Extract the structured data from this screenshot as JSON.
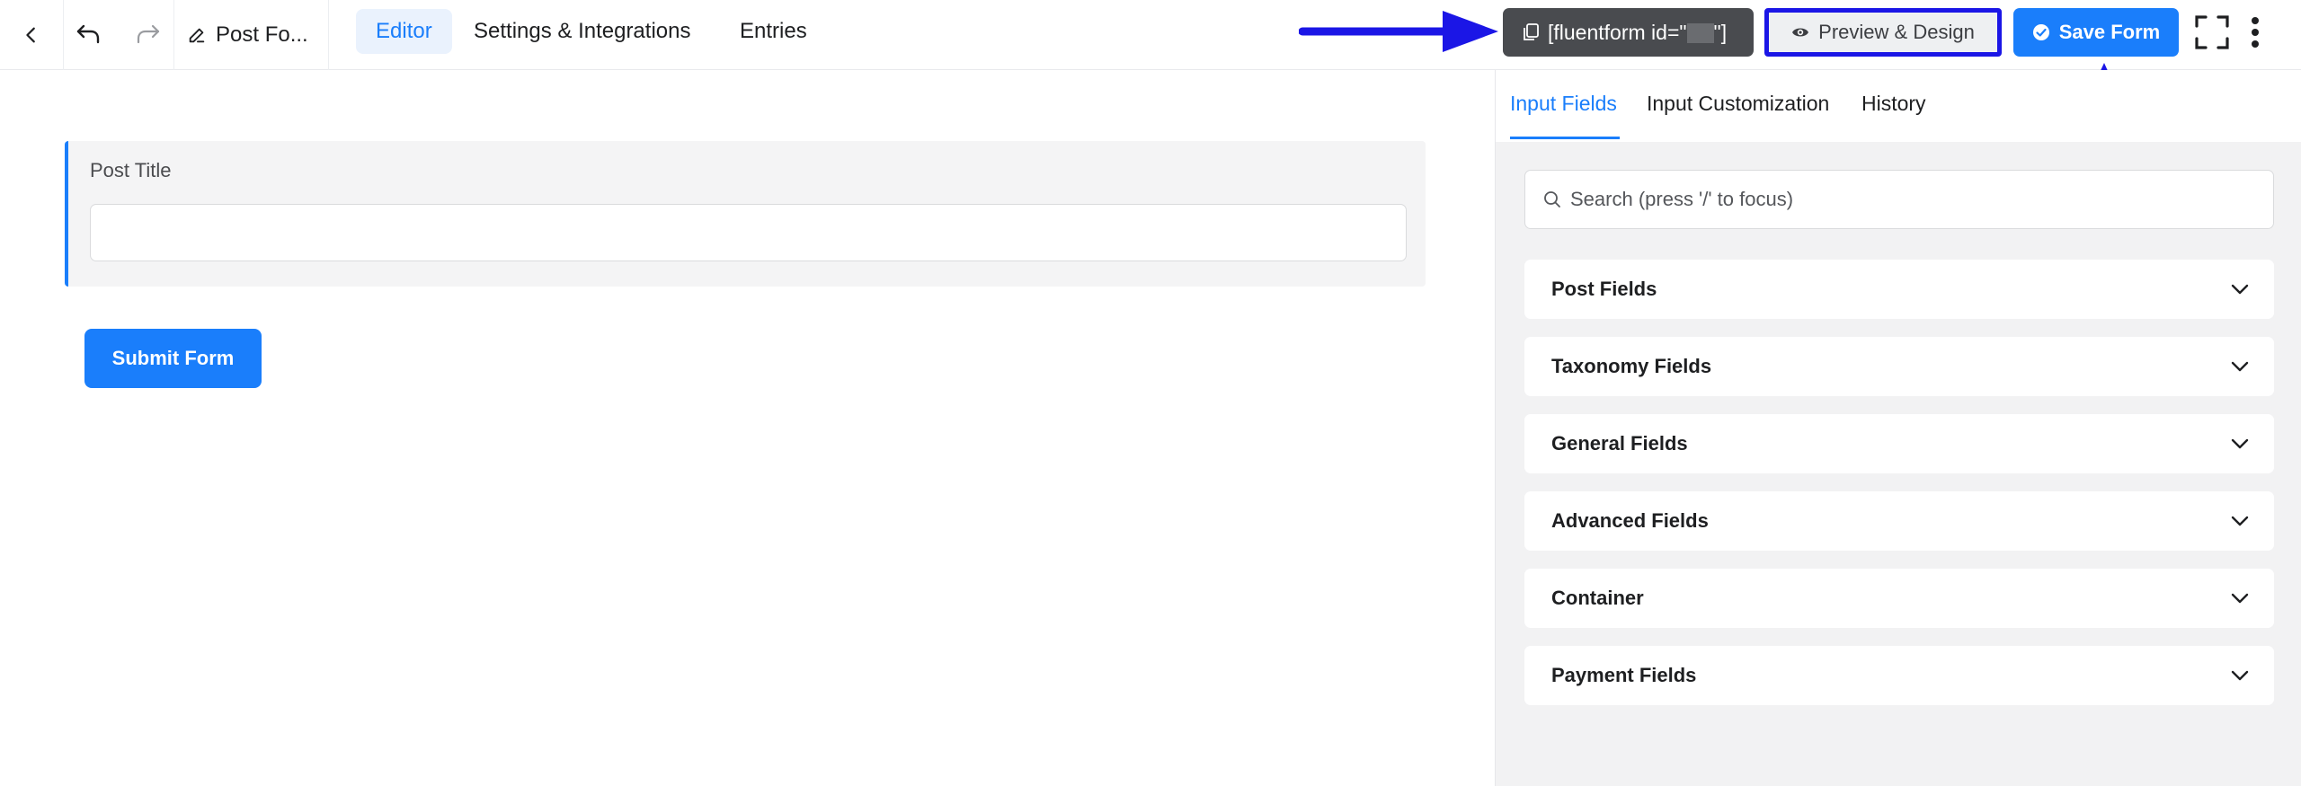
{
  "topbar": {
    "form_title": "Post Fo...",
    "tabs": [
      {
        "label": "Editor",
        "active": true
      },
      {
        "label": "Settings & Integrations",
        "active": false
      },
      {
        "label": "Entries",
        "active": false
      }
    ],
    "shortcode_prefix": "[fluentform id=\"",
    "shortcode_suffix": "\"]",
    "preview_label": "Preview & Design",
    "save_label": "Save Form"
  },
  "editor": {
    "field_label": "Post Title",
    "field_value": "",
    "submit_label": "Submit Form"
  },
  "panel": {
    "tabs": [
      {
        "label": "Input Fields",
        "active": true
      },
      {
        "label": "Input Customization",
        "active": false
      },
      {
        "label": "History",
        "active": false
      }
    ],
    "search_placeholder": "Search (press '/' to focus)",
    "groups": [
      {
        "label": "Post Fields"
      },
      {
        "label": "Taxonomy Fields"
      },
      {
        "label": "General Fields"
      },
      {
        "label": "Advanced Fields"
      },
      {
        "label": "Container"
      },
      {
        "label": "Payment Fields"
      }
    ]
  },
  "colors": {
    "accent": "#1a7efb",
    "annotation_blue": "#1b16e6",
    "shortcode_bg": "#494b4f",
    "panel_bg": "#f2f2f3"
  },
  "icons": [
    "chevron-left-icon",
    "undo-icon",
    "redo-icon",
    "pencil-icon",
    "copy-icon",
    "eye-icon",
    "check-circle-icon",
    "fullscreen-icon",
    "kebab-menu-icon",
    "search-icon",
    "chevron-down-icon"
  ]
}
